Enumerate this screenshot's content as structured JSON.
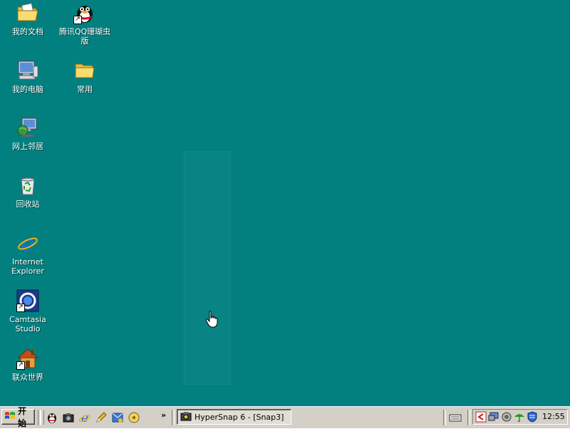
{
  "desktop": {
    "background_color": "#028080",
    "icons": [
      {
        "id": "my-documents",
        "label": "我的文档",
        "icon": "folder-documents-icon"
      },
      {
        "id": "qq",
        "label": "腾讯QQ珊瑚虫版",
        "icon": "qq-penguin-icon",
        "shortcut": true
      },
      {
        "id": "my-computer",
        "label": "我的电脑",
        "icon": "computer-icon"
      },
      {
        "id": "common-folder",
        "label": "常用",
        "icon": "folder-icon"
      },
      {
        "id": "network",
        "label": "网上邻居",
        "icon": "network-places-icon"
      },
      {
        "id": "recycle-bin",
        "label": "回收站",
        "icon": "recycle-bin-icon"
      },
      {
        "id": "internet-explorer",
        "label": "Internet Explorer",
        "icon": "internet-explorer-icon"
      },
      {
        "id": "camtasia",
        "label": "Camtasia Studio",
        "icon": "camtasia-icon",
        "shortcut": true
      },
      {
        "id": "lianzhong",
        "label": "联众世界",
        "icon": "house-icon",
        "shortcut": true
      }
    ]
  },
  "taskbar": {
    "start_label": "开始",
    "quick_launch": [
      "qq-penguin-icon",
      "camera-icon",
      "internet-explorer-icon",
      "pencil-icon",
      "outlook-icon",
      "media-icon"
    ],
    "more_label": "»",
    "tasks": [
      {
        "label": "HyperSnap 6 - [Snap3]",
        "icon": "hypersnap-icon",
        "active": true
      }
    ],
    "tray_icons": [
      "camtasia-recorder-icon",
      "monitor-icon",
      "speaker-icon",
      "antivirus-umbrella-icon",
      "shield-icon"
    ],
    "clock": "12:55"
  }
}
